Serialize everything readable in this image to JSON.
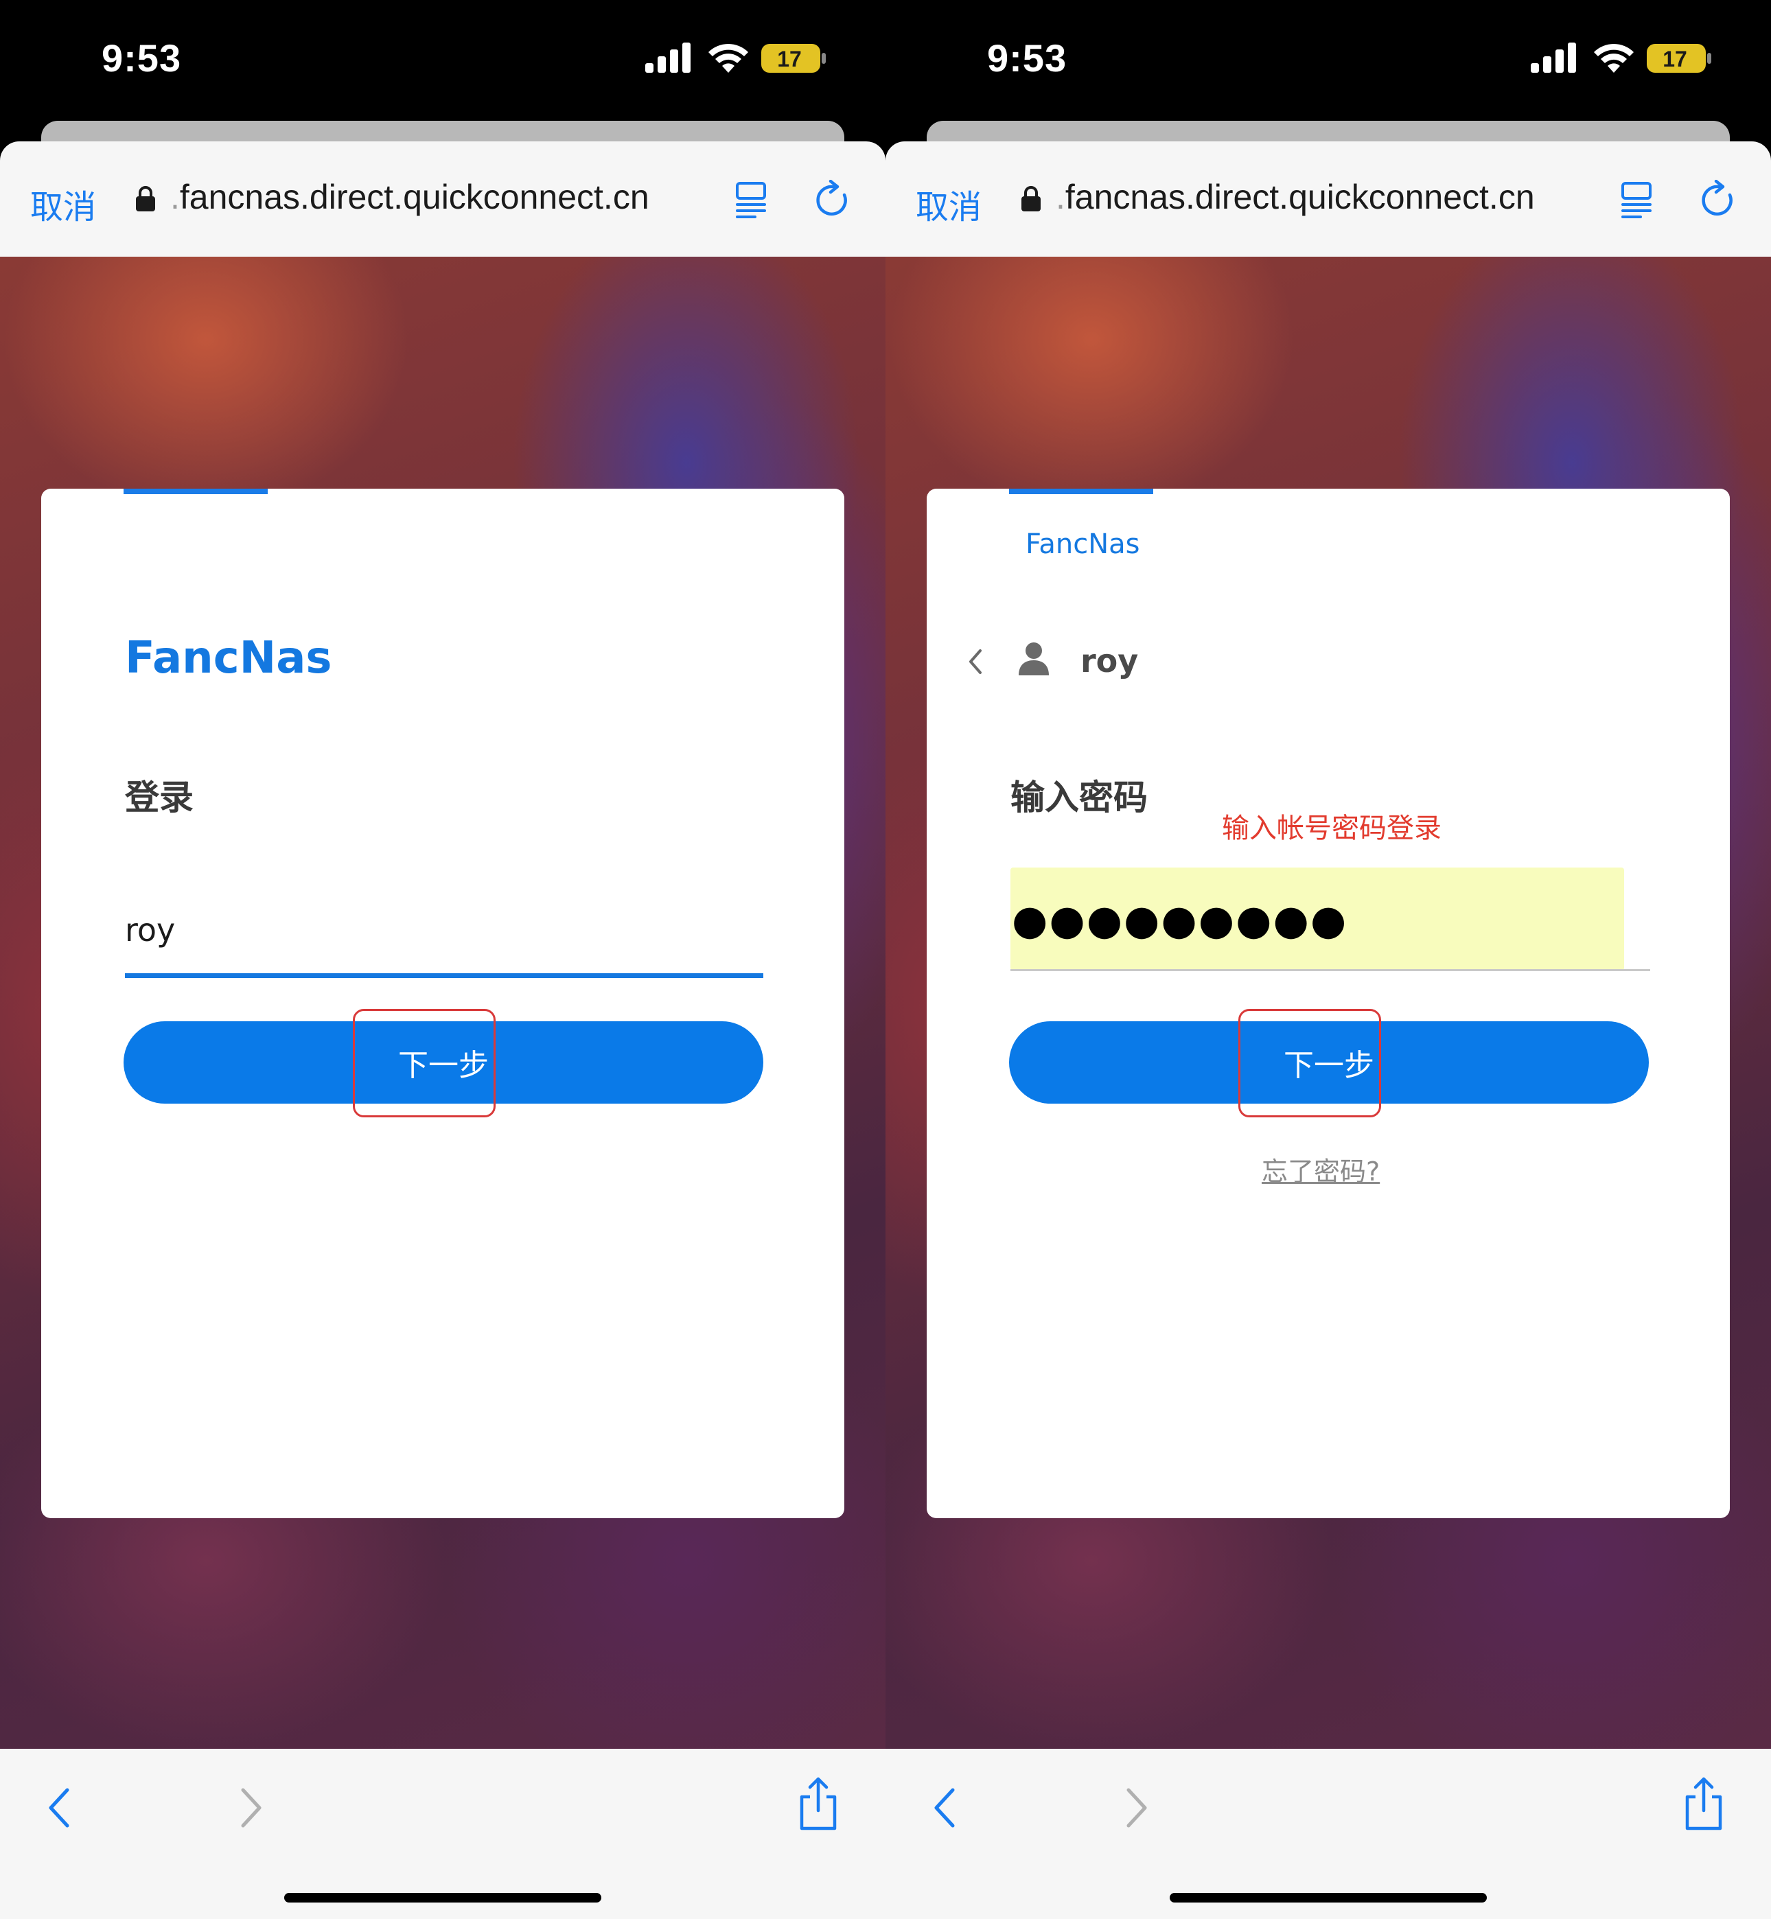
{
  "screens": [
    {
      "status": {
        "time": "9:53",
        "battery": "17"
      },
      "browser": {
        "cancel_label": "取消",
        "url_prefix": ".",
        "url_domain": "fancnas.direct.quickconnect.cn"
      },
      "card": {
        "brand": "FancNas",
        "heading": "登录",
        "username_value": "roy",
        "next_label": "下一步"
      }
    },
    {
      "status": {
        "time": "9:53",
        "battery": "17"
      },
      "browser": {
        "cancel_label": "取消",
        "url_prefix": ".",
        "url_domain": "fancnas.direct.quickconnect.cn"
      },
      "card": {
        "brand": "FancNas",
        "username": "roy",
        "heading": "输入密码",
        "annotation": "输入帐号密码登录",
        "password_masked": "●●●●●●●●●",
        "next_label": "下一步",
        "forgot_label": "忘了密码?"
      }
    }
  ],
  "colors": {
    "accent": "#0a7ae8",
    "annotation": "#e23b2e",
    "autofill": "#f8fcbd"
  },
  "icons": [
    "lock-icon",
    "reader-icon",
    "reload-icon",
    "back-icon",
    "forward-icon",
    "share-icon",
    "user-icon",
    "chevron-left-icon"
  ]
}
